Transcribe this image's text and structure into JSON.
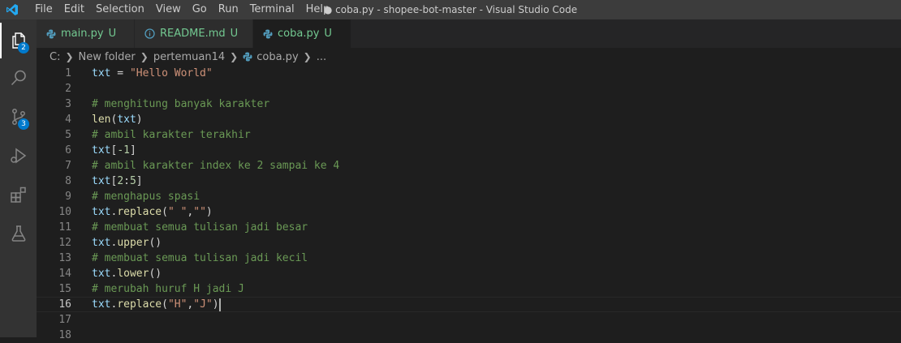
{
  "titlebar": {
    "menu": [
      "File",
      "Edit",
      "Selection",
      "View",
      "Go",
      "Run",
      "Terminal",
      "Help"
    ],
    "window_title": "● coba.py - shopee-bot-master - Visual Studio Code"
  },
  "activity_bar": {
    "items": [
      {
        "name": "explorer",
        "badge": "2"
      },
      {
        "name": "search",
        "badge": ""
      },
      {
        "name": "source-control",
        "badge": "3"
      },
      {
        "name": "run-debug",
        "badge": ""
      },
      {
        "name": "extensions",
        "badge": ""
      },
      {
        "name": "testing",
        "badge": ""
      }
    ]
  },
  "tabs": [
    {
      "label": "main.py",
      "status": "U",
      "icon": "python-icon",
      "active": false
    },
    {
      "label": "README.md",
      "status": "U",
      "icon": "info-icon",
      "active": false
    },
    {
      "label": "coba.py",
      "status": "U",
      "icon": "python-icon",
      "active": true
    }
  ],
  "breadcrumb": [
    "C:",
    "New folder",
    "pertemuan14",
    "coba.py",
    "..."
  ],
  "editor": {
    "current_line": 16,
    "lines": [
      {
        "n": "1",
        "tokens": [
          [
            "var",
            "txt"
          ],
          [
            "op",
            " = "
          ],
          [
            "str",
            "\"Hello World\""
          ]
        ]
      },
      {
        "n": "2",
        "tokens": []
      },
      {
        "n": "3",
        "tokens": [
          [
            "cmt",
            "# menghitung banyak karakter"
          ]
        ]
      },
      {
        "n": "4",
        "tokens": [
          [
            "fn",
            "len"
          ],
          [
            "op",
            "("
          ],
          [
            "var",
            "txt"
          ],
          [
            "op",
            ")"
          ]
        ]
      },
      {
        "n": "5",
        "tokens": [
          [
            "cmt",
            "# ambil karakter terakhir"
          ]
        ]
      },
      {
        "n": "6",
        "tokens": [
          [
            "var",
            "txt"
          ],
          [
            "op",
            "["
          ],
          [
            "num",
            "-1"
          ],
          [
            "op",
            "]"
          ]
        ]
      },
      {
        "n": "7",
        "tokens": [
          [
            "cmt",
            "# ambil karakter index ke 2 sampai ke 4"
          ]
        ]
      },
      {
        "n": "8",
        "tokens": [
          [
            "var",
            "txt"
          ],
          [
            "op",
            "["
          ],
          [
            "num",
            "2"
          ],
          [
            "op",
            ":"
          ],
          [
            "num",
            "5"
          ],
          [
            "op",
            "]"
          ]
        ]
      },
      {
        "n": "9",
        "tokens": [
          [
            "cmt",
            "# menghapus spasi"
          ]
        ]
      },
      {
        "n": "10",
        "tokens": [
          [
            "var",
            "txt"
          ],
          [
            "op",
            "."
          ],
          [
            "fn",
            "replace"
          ],
          [
            "op",
            "("
          ],
          [
            "str",
            "\" \""
          ],
          [
            "op",
            ","
          ],
          [
            "str",
            "\"\""
          ],
          [
            "op",
            ")"
          ]
        ]
      },
      {
        "n": "11",
        "tokens": [
          [
            "cmt",
            "# membuat semua tulisan jadi besar"
          ]
        ]
      },
      {
        "n": "12",
        "tokens": [
          [
            "var",
            "txt"
          ],
          [
            "op",
            "."
          ],
          [
            "fn",
            "upper"
          ],
          [
            "op",
            "()"
          ]
        ]
      },
      {
        "n": "13",
        "tokens": [
          [
            "cmt",
            "# membuat semua tulisan jadi kecil"
          ]
        ]
      },
      {
        "n": "14",
        "tokens": [
          [
            "var",
            "txt"
          ],
          [
            "op",
            "."
          ],
          [
            "fn",
            "lower"
          ],
          [
            "op",
            "()"
          ]
        ]
      },
      {
        "n": "15",
        "tokens": [
          [
            "cmt",
            "# merubah huruf H jadi J"
          ]
        ]
      },
      {
        "n": "16",
        "tokens": [
          [
            "var",
            "txt"
          ],
          [
            "op",
            "."
          ],
          [
            "fn",
            "replace"
          ],
          [
            "op",
            "("
          ],
          [
            "str",
            "\"H\""
          ],
          [
            "op",
            ","
          ],
          [
            "str",
            "\"J\""
          ],
          [
            "op",
            ")"
          ]
        ]
      },
      {
        "n": "17",
        "tokens": []
      },
      {
        "n": "18",
        "tokens": []
      }
    ]
  },
  "colors": {
    "accent": "#007acc",
    "untracked": "#73c991",
    "comment": "#6a9955",
    "string": "#ce9178",
    "function": "#dcdcaa",
    "variable": "#9cdcfe",
    "number": "#b5cea8"
  }
}
